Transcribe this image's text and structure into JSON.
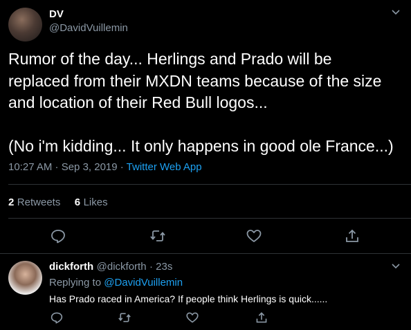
{
  "main_tweet": {
    "author_name": "DV",
    "author_handle": "@DavidVuillemin",
    "text": "Rumor of the day... Herlings and Prado will be replaced from their MXDN teams because of the size and location of their Red Bull logos...\n\n(No i'm kidding... It only happens in good ole France...)",
    "timestamp": "10:27 AM · Sep 3, 2019 · ",
    "source": "Twitter Web App",
    "retweets_count": "2",
    "retweets_label": "Retweets",
    "likes_count": "6",
    "likes_label": "Likes"
  },
  "reply": {
    "author_name": "dickforth",
    "author_handle": "@dickforth",
    "time": "· 23s",
    "replying_prefix": "Replying to ",
    "replying_to": "@DavidVuillemin",
    "text": "Has Prado raced in America? If people think Herlings is quick......"
  },
  "icons": {
    "menu": "chevron-down-icon",
    "reply": "reply-icon",
    "retweet": "retweet-icon",
    "like": "heart-icon",
    "share": "share-icon"
  },
  "colors": {
    "background": "#000000",
    "link": "#1da1f2",
    "muted": "#8b98a5",
    "divider": "#2f3336"
  }
}
